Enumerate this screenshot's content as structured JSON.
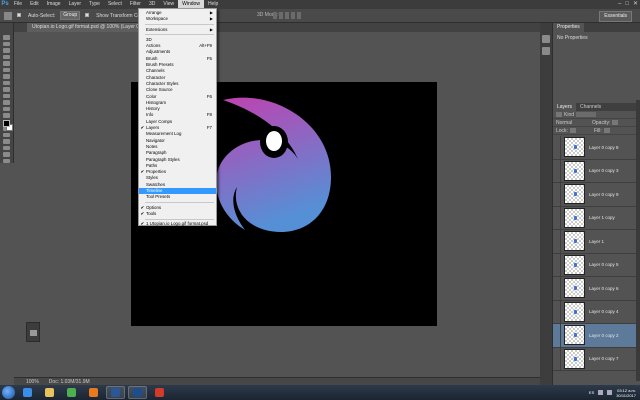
{
  "app": {
    "logo": "Ps"
  },
  "menubar": {
    "items": [
      "File",
      "Edit",
      "Image",
      "Layer",
      "Type",
      "Select",
      "Filter",
      "3D",
      "View",
      "Window",
      "Help"
    ],
    "active": "Window"
  },
  "options_bar": {
    "auto_select_label": "Auto-Select:",
    "auto_select_value": "Group",
    "show_transform_label": "Show Transform Controls",
    "mode_3d_label": "3D Mode:",
    "workspace": "Essentials"
  },
  "document": {
    "tab_title": "Utopian.io Logo.gif format.psd @ 100% (Layer 0 copy 2, RGB/8)",
    "zoom": "100%",
    "doc_size": "Doc: 1.03M/31.9M"
  },
  "window_menu": {
    "items": [
      {
        "label": "Arrange",
        "submenu": true
      },
      {
        "label": "Workspace",
        "submenu": true
      },
      {
        "sep": true
      },
      {
        "label": "Extensions",
        "submenu": true
      },
      {
        "sep": true
      },
      {
        "label": "3D"
      },
      {
        "label": "Actions",
        "shortcut": "Alt+F9"
      },
      {
        "label": "Adjustments"
      },
      {
        "label": "Brush",
        "shortcut": "F5"
      },
      {
        "label": "Brush Presets"
      },
      {
        "label": "Channels"
      },
      {
        "label": "Character"
      },
      {
        "label": "Character Styles"
      },
      {
        "label": "Clone Source"
      },
      {
        "label": "Color",
        "shortcut": "F6"
      },
      {
        "label": "Histogram"
      },
      {
        "label": "History"
      },
      {
        "label": "Info",
        "shortcut": "F8"
      },
      {
        "label": "Layer Comps"
      },
      {
        "label": "Layers",
        "shortcut": "F7",
        "checked": true
      },
      {
        "label": "Measurement Log"
      },
      {
        "label": "Navigator"
      },
      {
        "label": "Notes"
      },
      {
        "label": "Paragraph"
      },
      {
        "label": "Paragraph Styles"
      },
      {
        "label": "Paths"
      },
      {
        "label": "Properties",
        "checked": true
      },
      {
        "label": "Styles"
      },
      {
        "label": "Swatches"
      },
      {
        "label": "Timeline",
        "highlighted": true
      },
      {
        "label": "Tool Presets"
      },
      {
        "sep": true
      },
      {
        "label": "Options",
        "checked": true
      },
      {
        "label": "Tools",
        "checked": true
      },
      {
        "sep": true
      },
      {
        "label": "1 Utopian.io Logo.gif format.psd",
        "checked": true
      }
    ]
  },
  "properties_panel": {
    "title": "Properties",
    "subtitle": "No Properties"
  },
  "layers_panel": {
    "tabs": [
      "Layers",
      "Channels"
    ],
    "active_tab": "Layers",
    "kind_label": "Kind",
    "blend_mode": "Normal",
    "opacity_label": "Opacity:",
    "lock_label": "Lock:",
    "fill_label": "Fill:",
    "layers": [
      {
        "name": "Layer 0 copy 8",
        "selected": false
      },
      {
        "name": "Layer 0 copy 3",
        "selected": false
      },
      {
        "name": "Layer 0 copy 9",
        "selected": false
      },
      {
        "name": "Layer 1 copy",
        "selected": false
      },
      {
        "name": "Layer 1",
        "selected": false
      },
      {
        "name": "Layer 0 copy 5",
        "selected": false
      },
      {
        "name": "Layer 0 copy 6",
        "selected": false
      },
      {
        "name": "Layer 0 copy 4",
        "selected": false
      },
      {
        "name": "Layer 0 copy 2",
        "selected": true
      },
      {
        "name": "Layer 0 copy 7",
        "selected": false
      }
    ]
  },
  "taskbar": {
    "apps": [
      {
        "name": "ie-icon",
        "color": "#3b8ee8",
        "running": false
      },
      {
        "name": "explorer-icon",
        "color": "#e8c25a",
        "running": false
      },
      {
        "name": "chrome-icon",
        "color": "#4caf50",
        "running": false
      },
      {
        "name": "firefox-icon",
        "color": "#e8791e",
        "running": false
      },
      {
        "name": "word-icon",
        "color": "#2b5797",
        "running": true
      },
      {
        "name": "photoshop-icon",
        "color": "#1e4c8c",
        "running": true
      },
      {
        "name": "media-icon",
        "color": "#d23a2a",
        "running": false
      }
    ],
    "time": "03:12 a.m.",
    "date": "30/11/2017",
    "lang": "ES"
  },
  "colors": {
    "logo_gradient_start": "#c041b0",
    "logo_gradient_end": "#5590d6",
    "menu_highlight": "#3399ff"
  }
}
